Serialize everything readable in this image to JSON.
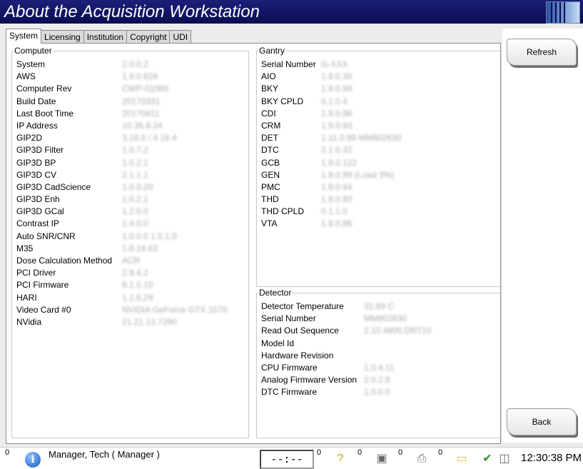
{
  "window": {
    "title": "About the Acquisition Workstation"
  },
  "tabs": [
    {
      "label": "System",
      "active": true
    },
    {
      "label": "Licensing",
      "active": false
    },
    {
      "label": "Institution",
      "active": false
    },
    {
      "label": "Copyright",
      "active": false
    },
    {
      "label": "UDI",
      "active": false
    }
  ],
  "computer": {
    "legend": "Computer",
    "rows": [
      {
        "label": "System",
        "value": "2.0.0.2"
      },
      {
        "label": "AWS",
        "value": "1.9.0.624"
      },
      {
        "label": "Computer Rev",
        "value": "CWP-01065"
      },
      {
        "label": "Build Date",
        "value": "20170331"
      },
      {
        "label": "Last Boot Time",
        "value": "20170411"
      },
      {
        "label": "IP Address",
        "value": "10.36.8.24"
      },
      {
        "label": "GIP2D",
        "value": "3.16.0 / 4.16.4"
      },
      {
        "label": "GIP3D Filter",
        "value": "1.0.7.2"
      },
      {
        "label": "GIP3D BP",
        "value": "1.0.2.1"
      },
      {
        "label": "GIP3D CV",
        "value": "2.1.1.1"
      },
      {
        "label": "GIP3D CadScience",
        "value": "1.0.0.20"
      },
      {
        "label": "GIP3D Enh",
        "value": "1.0.2.1"
      },
      {
        "label": "GIP3D GCal",
        "value": "1.2.0.0"
      },
      {
        "label": "Contrast IP",
        "value": "1.4.0.0"
      },
      {
        "label": "Auto SNR/CNR",
        "value": "1.0.0.0 1.0.1.0"
      },
      {
        "label": "M35",
        "value": "1.6.16.63"
      },
      {
        "label": "Dose Calculation Method",
        "value": "ACR"
      },
      {
        "label": "PCI Driver",
        "value": "2.9.4.2"
      },
      {
        "label": "PCI Firmware",
        "value": "8.1.0.10"
      },
      {
        "label": "HARI",
        "value": "1.1.6.29"
      },
      {
        "label": "Video Card #0",
        "value": "NVIDIA GeForce GTX 1070"
      },
      {
        "label": "NVidia",
        "value": "21.21.13.7290"
      }
    ]
  },
  "gantry": {
    "legend": "Gantry",
    "rows": [
      {
        "label": "Serial Number",
        "value": "G-XXX"
      },
      {
        "label": "AIO",
        "value": "1.9.0.35"
      },
      {
        "label": "BKY",
        "value": "1.9.0.98"
      },
      {
        "label": "BKY CPLD",
        "value": "0.1.0.4"
      },
      {
        "label": "CDI",
        "value": "1.9.0.98"
      },
      {
        "label": "CRM",
        "value": "1.9.0.93"
      },
      {
        "label": "DET",
        "value": "1.11.0.89 MM802630"
      },
      {
        "label": "DTC",
        "value": "2.1.0.32"
      },
      {
        "label": "GCB",
        "value": "1.9.0.122"
      },
      {
        "label": "GEN",
        "value": "1.9.0.99 (Load 3%)"
      },
      {
        "label": "PMC",
        "value": "1.9.0.94"
      },
      {
        "label": "THD",
        "value": "1.9.0.93"
      },
      {
        "label": "THD CPLD",
        "value": "0.1.1.0"
      },
      {
        "label": "VTA",
        "value": "1.9.0.86"
      }
    ]
  },
  "detector": {
    "legend": "Detector",
    "rows": [
      {
        "label": "Detector Temperature",
        "value": "31.89 C"
      },
      {
        "label": "Serial Number",
        "value": "MM802630"
      },
      {
        "label": "Read Out Sequence",
        "value": "2.10.4800.DRT10"
      },
      {
        "label": "Model Id",
        "value": ""
      },
      {
        "label": "Hardware Revision",
        "value": ""
      },
      {
        "label": "CPU Firmware",
        "value": "1.0.4.11"
      },
      {
        "label": "Analog Firmware Version",
        "value": "2.0.2.8"
      },
      {
        "label": "DTC Firmware",
        "value": "1.0.0.0"
      }
    ]
  },
  "buttons": {
    "refresh": "Refresh",
    "back": "Back"
  },
  "taskbar": {
    "info_count": "0",
    "user": "Manager, Tech ( Manager )",
    "timer": "--:--",
    "counts": [
      "0",
      "0",
      "0",
      "0"
    ],
    "clock": "12:30:38 PM",
    "icons": [
      "info-icon",
      "help-icon",
      "camera-icon",
      "printer-icon",
      "notes-icon",
      "check-icon",
      "network-icon"
    ]
  }
}
